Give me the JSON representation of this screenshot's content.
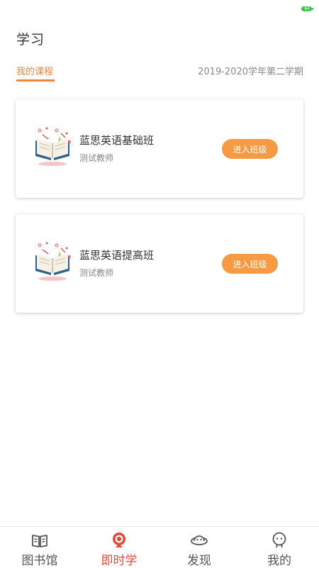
{
  "status_bar": {
    "battery": "64"
  },
  "header": {
    "title": "学习"
  },
  "tabs": {
    "active_label": "我的课程",
    "term": "2019-2020学年第二学期"
  },
  "courses": [
    {
      "name": "蓝思英语基础班",
      "teacher": "测试教师",
      "button": "进入班级"
    },
    {
      "name": "蓝思英语提高班",
      "teacher": "测试教师",
      "button": "进入班级"
    }
  ],
  "bottom_nav": [
    {
      "label": "图书馆",
      "icon": "book-open-icon",
      "active": false
    },
    {
      "label": "即时学",
      "icon": "live-study-icon",
      "active": true
    },
    {
      "label": "发现",
      "icon": "planet-icon",
      "active": false
    },
    {
      "label": "我的",
      "icon": "profile-face-icon",
      "active": false
    }
  ],
  "colors": {
    "accent": "#f0853b",
    "button": "#f79a44",
    "nav_active": "#e24a3b"
  }
}
